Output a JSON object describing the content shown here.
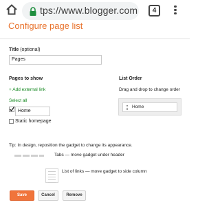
{
  "browser": {
    "url": "tps://www.blogger.com",
    "tab_count": "4",
    "icons": {
      "home": "home-icon",
      "lock": "lock-icon",
      "menu": "more-vert-icon"
    }
  },
  "dialog": {
    "title": "Configure page list",
    "title_field": {
      "label": "Title",
      "optional": "(optional)",
      "value": "Pages"
    },
    "pages_to_show": {
      "heading": "Pages to show",
      "add_link": "+ Add external link",
      "select_all": "Select all",
      "items": [
        {
          "label": "Home",
          "checked": true
        },
        {
          "label": "Static homepage",
          "checked": false
        }
      ]
    },
    "list_order": {
      "heading": "List Order",
      "hint": "Drag and drop to change order",
      "items": [
        "Home"
      ]
    },
    "tip": "Tip: In design, reposition the gadget to change its appearance.",
    "layouts": [
      {
        "icon": "tabs-layout-icon",
        "text": "Tabs — move gadget under header"
      },
      {
        "icon": "list-layout-icon",
        "text": "List of links — move gadget to side column"
      }
    ],
    "buttons": {
      "save": "Save",
      "cancel": "Cancel",
      "remove": "Remove"
    },
    "colors": {
      "accent": "#f0743b",
      "title": "#e8712b",
      "link": "#11861d"
    }
  }
}
